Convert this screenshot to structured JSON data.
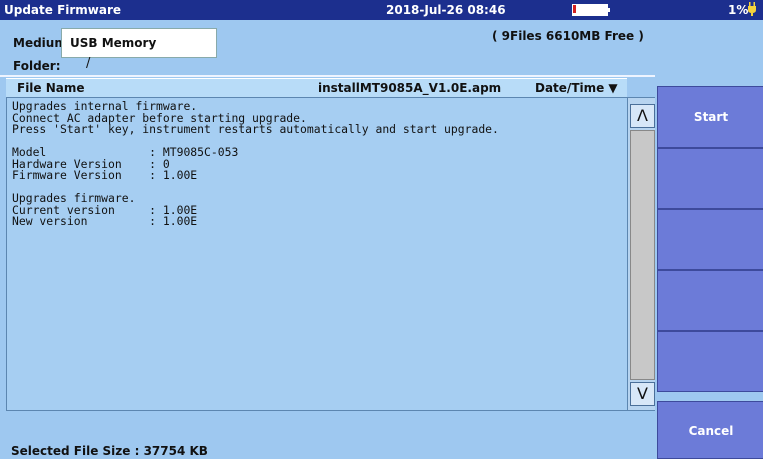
{
  "topbar": {
    "title": "Update Firmware",
    "datetime": "2018-Jul-26 08:46",
    "battery_percent": "1%",
    "battery_level": 0.01,
    "battery_color": "#d32020"
  },
  "header": {
    "medium_label": "Medium:",
    "medium_value": "USB Memory",
    "free_info": "( 9Files  6610MB Free )",
    "folder_label": "Folder:",
    "folder_value": "/"
  },
  "columns": {
    "file_name": "File Name",
    "selected_file": "installMT9085A_V1.0E.apm",
    "date_time": "Date/Time ▼"
  },
  "content_text": "Upgrades internal firmware.\nConnect AC adapter before starting upgrade.\nPress 'Start' key, instrument restarts automatically and start upgrade.\n\nModel               : MT9085C-053\nHardware Version    : 0\nFirmware Version    : 1.00E\n\nUpgrades firmware.\nCurrent version     : 1.00E\nNew version         : 1.00E",
  "scroll": {
    "up_icon": "Λ",
    "down_icon": "V"
  },
  "footer": {
    "selected_size": "Selected File Size : 37754 KB"
  },
  "function_keys": [
    "Start",
    "",
    "",
    "",
    "",
    "Cancel"
  ],
  "colors": {
    "titlebar": "#1c2f8e",
    "background": "#9ec8f0",
    "fkey": "#6c7bd8"
  }
}
